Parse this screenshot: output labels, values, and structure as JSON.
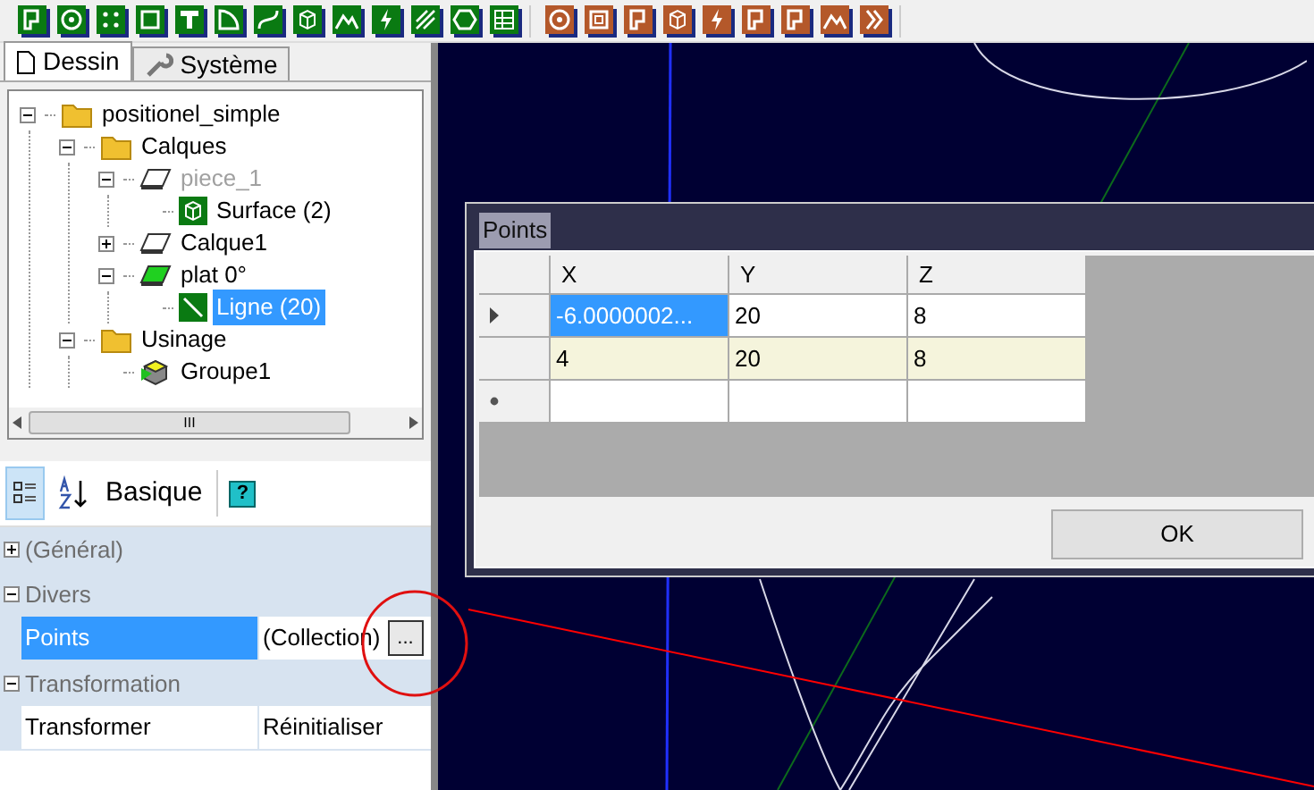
{
  "toolbar": {
    "groups": [
      {
        "color": "#0a7a12",
        "tools": [
          {
            "kind": "p"
          },
          {
            "kind": "circle"
          },
          {
            "kind": "dots"
          },
          {
            "kind": "square"
          },
          {
            "kind": "t"
          },
          {
            "kind": "arc"
          },
          {
            "kind": "curve"
          },
          {
            "kind": "cube"
          },
          {
            "kind": "mountain"
          },
          {
            "kind": "bolt"
          },
          {
            "kind": "hatch"
          },
          {
            "kind": "hex"
          },
          {
            "kind": "table"
          }
        ]
      },
      {
        "color": "#b4582a",
        "tools": [
          {
            "kind": "target"
          },
          {
            "kind": "spiral"
          },
          {
            "kind": "p"
          },
          {
            "kind": "cube"
          },
          {
            "kind": "bolt"
          },
          {
            "kind": "p"
          },
          {
            "kind": "p"
          },
          {
            "kind": "mountain"
          },
          {
            "kind": "chevrons"
          }
        ]
      }
    ]
  },
  "tabs": [
    {
      "label": "Dessin",
      "kind": "page",
      "selected": true
    },
    {
      "label": "Système",
      "kind": "wrench",
      "selected": false
    }
  ],
  "tree": [
    {
      "label": "positionel_simple",
      "kind": "folder",
      "expanded": true,
      "selected": false,
      "disabled": false,
      "children": [
        {
          "label": "Calques",
          "kind": "folder",
          "expanded": true,
          "selected": false,
          "disabled": false,
          "children": [
            {
              "label": "piece_1",
              "kind": "layer",
              "expanded": true,
              "selected": false,
              "disabled": true,
              "children": [
                {
                  "label": "Surface (2)",
                  "kind": "surface",
                  "selected": false,
                  "disabled": false
                }
              ]
            },
            {
              "label": "Calque1",
              "kind": "layer",
              "expanded": false,
              "selected": false,
              "disabled": false
            },
            {
              "label": "plat 0°",
              "kind": "greenlayer",
              "expanded": true,
              "selected": false,
              "disabled": false,
              "children": [
                {
                  "label": "Ligne (20)",
                  "kind": "line",
                  "selected": true,
                  "disabled": false
                }
              ]
            }
          ]
        },
        {
          "label": "Usinage",
          "kind": "folder",
          "expanded": true,
          "selected": false,
          "disabled": false,
          "children": [
            {
              "label": "Groupe1",
              "kind": "group",
              "selected": false,
              "disabled": false
            }
          ]
        }
      ]
    }
  ],
  "tree_scroll_thumb": "III",
  "properties": {
    "toolbar": {
      "categorized_selected": true,
      "basic_label": "Basique",
      "help_label": "?"
    },
    "categories": [
      {
        "label": "(Général)",
        "expanded": false
      },
      {
        "label": "Divers",
        "expanded": true,
        "rows": [
          {
            "name": "Points",
            "value": "(Collection)",
            "button": "...",
            "selected": true
          }
        ]
      },
      {
        "label": "Transformation",
        "expanded": true,
        "rows": [
          {
            "name": "Transformer",
            "value": "Réinitialiser",
            "selected": false
          }
        ]
      }
    ]
  },
  "dialog": {
    "title": "Points",
    "columns": [
      "X",
      "Y",
      "Z"
    ],
    "rows": [
      {
        "kind": "current",
        "cells": [
          {
            "text": "-6.0000002...",
            "selected": true
          },
          {
            "text": "20",
            "selected": false
          },
          {
            "text": "8",
            "selected": false
          }
        ]
      },
      {
        "kind": "normal",
        "cells": [
          {
            "text": "4",
            "selected": false
          },
          {
            "text": "20",
            "selected": false
          },
          {
            "text": "8",
            "selected": false
          }
        ]
      },
      {
        "kind": "new",
        "cells": [
          {
            "text": "",
            "selected": false
          },
          {
            "text": "",
            "selected": false
          },
          {
            "text": "",
            "selected": false
          }
        ]
      }
    ],
    "ok_label": "OK"
  }
}
